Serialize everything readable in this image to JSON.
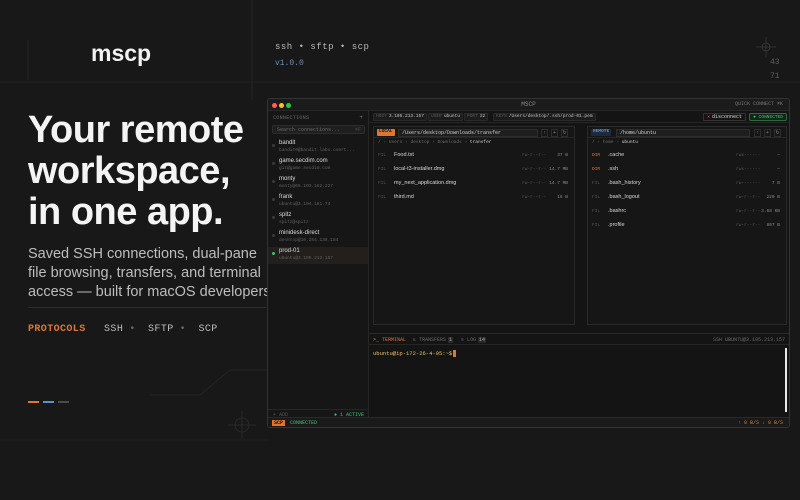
{
  "hero": {
    "brand": "mscp",
    "protocol_line": "ssh • sftp • scp",
    "version": "v1.0.0",
    "coords": [
      "43",
      "71"
    ],
    "headline": [
      "Your remote",
      "workspace,",
      "in one app."
    ],
    "subtext": "Saved SSH connections, dual-pane file browsing, transfers, and terminal access — built for macOS developers.",
    "protocols_label": "PROTOCOLS",
    "protocols": [
      "SSH",
      "SFTP",
      "SCP"
    ],
    "accent_bars": [
      "#e0762d",
      "#5b8fd0",
      "#4a4a4a"
    ]
  },
  "app": {
    "window_title": "MSCP",
    "quick_connect": "QUICK CONNECT ⌘K",
    "sidebar": {
      "title": "CONNECTIONS",
      "add": "+",
      "search_placeholder": "Search connections...",
      "search_shortcut": "⌘F",
      "connections": [
        {
          "name": "bandit",
          "host": "bandit0@bandit.labs.overt..."
        },
        {
          "name": "game.secdim.com",
          "host": "git@game.secdim.com"
        },
        {
          "name": "monty",
          "host": "monty@65.103.162.227"
        },
        {
          "name": "frank",
          "host": "ubuntu@3.104.181.74"
        },
        {
          "name": "spitz",
          "host": "spitz@spitz"
        },
        {
          "name": "minidesk-direct",
          "host": "desktop@10.254.138.184"
        },
        {
          "name": "prod-01",
          "host": "ubuntu@3.105.213.157",
          "active": true
        }
      ],
      "footer_left": "+ ADD",
      "footer_right": "● 1 ACTIVE"
    },
    "info_bar": [
      {
        "k": "HOST",
        "v": "3.105.213.157"
      },
      {
        "k": "USER",
        "v": "ubuntu"
      },
      {
        "k": "PORT",
        "v": "22"
      },
      {
        "k": "KEYS",
        "v": "/Users/desktop/.ssh/prod-01.pem"
      }
    ],
    "disconnect": "disconnect",
    "connected_badge": "● CONNECTED",
    "local": {
      "tag": "LOCAL",
      "path": "/Users/desktop/Downloads/transfer",
      "crumbs": [
        "/",
        "Users",
        "desktop",
        "Downloads"
      ],
      "crumb_current": "transfer",
      "files": [
        {
          "type": "FIL",
          "name": "Food.txt",
          "perm": "rw-r--r--",
          "size": "37 B"
        },
        {
          "type": "FIL",
          "name": "local-t3-installer.dmg",
          "perm": "rw-r--r--",
          "size": "14.7 MB"
        },
        {
          "type": "FIL",
          "name": "my_next_application.dmg",
          "perm": "rw-r--r--",
          "size": "14.7 MB"
        },
        {
          "type": "FIL",
          "name": "third.md",
          "perm": "rw-r--r--",
          "size": "16 B"
        }
      ]
    },
    "remote": {
      "tag": "REMOTE",
      "path": "/home/ubuntu",
      "crumbs": [
        "/",
        "home"
      ],
      "crumb_current": "ubuntu",
      "files": [
        {
          "type": "DIR",
          "name": ".cache",
          "perm": "rwx------",
          "size": "—"
        },
        {
          "type": "DIR",
          "name": ".ssh",
          "perm": "rwx------",
          "size": "—"
        },
        {
          "type": "FIL",
          "name": ".bash_history",
          "perm": "rw-------",
          "size": "7 B"
        },
        {
          "type": "FIL",
          "name": ".bash_logout",
          "perm": "rw-r--r--",
          "size": "220 B"
        },
        {
          "type": "FIL",
          "name": ".bashrc",
          "perm": "rw-r--r--",
          "size": "3.68 KB"
        },
        {
          "type": "FIL",
          "name": ".profile",
          "perm": "rw-r--r--",
          "size": "807 B"
        }
      ]
    },
    "terminal": {
      "tabs": [
        {
          "label": "TERMINAL",
          "icon": ">_"
        },
        {
          "label": "TRANSFERS",
          "count": "1"
        },
        {
          "label": "LOG",
          "count": "14"
        }
      ],
      "ssh_label": "SSH UBUNTU@3.105.213.157",
      "prompt": "ubuntu@ip-172-26-4-95:~$"
    },
    "statusbar": {
      "mode": "SCP",
      "status": "CONNECTED",
      "right": "↑ 0 B/S  ↓ 0 B/S"
    },
    "colors": {
      "accent": "#e0762d",
      "green": "#3ec46d",
      "blue": "#5b8fd0"
    }
  }
}
